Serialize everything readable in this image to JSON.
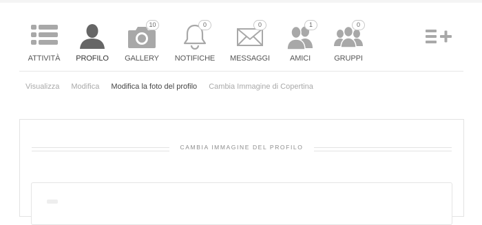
{
  "nav": {
    "items": [
      {
        "key": "attivita",
        "label": "ATTIVITÀ",
        "icon": "activity-list-icon",
        "badge": null
      },
      {
        "key": "profilo",
        "label": "PROFILO",
        "icon": "profile-user-icon",
        "badge": null
      },
      {
        "key": "gallery",
        "label": "GALLERY",
        "icon": "camera-icon",
        "badge": "10"
      },
      {
        "key": "notifiche",
        "label": "NOTIFICHE",
        "icon": "bell-icon",
        "badge": "0"
      },
      {
        "key": "messaggi",
        "label": "MESSAGGI",
        "icon": "envelope-icon",
        "badge": "0"
      },
      {
        "key": "amici",
        "label": "AMICI",
        "icon": "friends-icon",
        "badge": "1"
      },
      {
        "key": "gruppi",
        "label": "GRUPPI",
        "icon": "group-icon",
        "badge": "0"
      }
    ],
    "menu_icon": "menu-add-icon"
  },
  "subnav": {
    "items": [
      {
        "label": "Visualizza",
        "current": false
      },
      {
        "label": "Modifica",
        "current": false
      },
      {
        "label": "Modifica la foto del profilo",
        "current": true
      },
      {
        "label": "Cambia Immagine di Copertina",
        "current": false
      }
    ]
  },
  "panel": {
    "section_title": "CAMBIA IMMAGINE DEL PROFILO"
  },
  "colors": {
    "icon_gray": "#a8a8a8",
    "icon_active": "#666666",
    "text_muted": "#a9a9a9",
    "text_current": "#444444",
    "border": "#e2e2e2"
  }
}
